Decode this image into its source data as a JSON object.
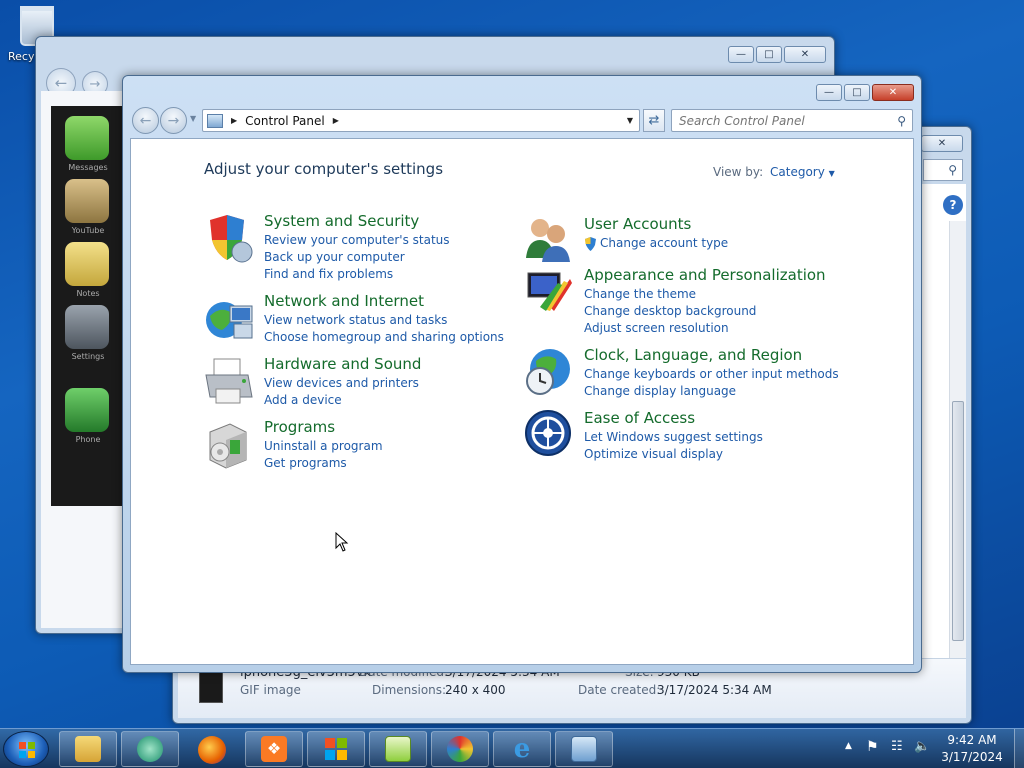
{
  "desktop": {
    "recycle_label": "Recy"
  },
  "back_window": {
    "apps": [
      "Messages",
      "YouTube",
      "Notes",
      "Settings",
      "Phone"
    ]
  },
  "explorer_window": {
    "file_name": "iphone3g_eiv3m5vk",
    "file_type": "GIF image",
    "modified_label": "Date modified:",
    "modified_value": "3/17/2024 5:34 AM",
    "dimensions_label": "Dimensions:",
    "dimensions_value": "240 x 400",
    "size_label": "Size:",
    "size_value": "930 KB",
    "created_label": "Date created:",
    "created_value": "3/17/2024 5:34 AM"
  },
  "control_panel": {
    "breadcrumb": "Control Panel",
    "search_placeholder": "Search Control Panel",
    "heading": "Adjust your computer's settings",
    "view_by_label": "View by:",
    "view_by_value": "Category",
    "categories": [
      {
        "title": "System and Security",
        "icon": "shield-icon",
        "links": [
          "Review your computer's status",
          "Back up your computer",
          "Find and fix problems"
        ]
      },
      {
        "title": "Network and Internet",
        "icon": "network-globe-icon",
        "links": [
          "View network status and tasks",
          "Choose homegroup and sharing options"
        ]
      },
      {
        "title": "Hardware and Sound",
        "icon": "printer-icon",
        "links": [
          "View devices and printers",
          "Add a device"
        ]
      },
      {
        "title": "Programs",
        "icon": "programs-box-icon",
        "links": [
          "Uninstall a program",
          "Get programs"
        ]
      },
      {
        "title": "User Accounts",
        "icon": "users-icon",
        "links": [
          "Change account type"
        ]
      },
      {
        "title": "Appearance and Personalization",
        "icon": "display-paint-icon",
        "links": [
          "Change the theme",
          "Change desktop background",
          "Adjust screen resolution"
        ]
      },
      {
        "title": "Clock, Language, and Region",
        "icon": "globe-clock-icon",
        "links": [
          "Change keyboards or other input methods",
          "Change display language"
        ]
      },
      {
        "title": "Ease of Access",
        "icon": "ease-of-access-icon",
        "links": [
          "Let Windows suggest settings",
          "Optimize visual display"
        ]
      }
    ]
  },
  "taskbar": {
    "time": "9:42 AM",
    "date": "3/17/2024",
    "apps": [
      "explorer",
      "photo-viewer",
      "firefox",
      "xampp",
      "windows-flag",
      "notepad-plus",
      "paint",
      "internet-explorer",
      "control-panel"
    ]
  },
  "colors": {
    "category_title": "#146b2c",
    "link": "#1e5aa8",
    "heading": "#1e3a5a"
  }
}
